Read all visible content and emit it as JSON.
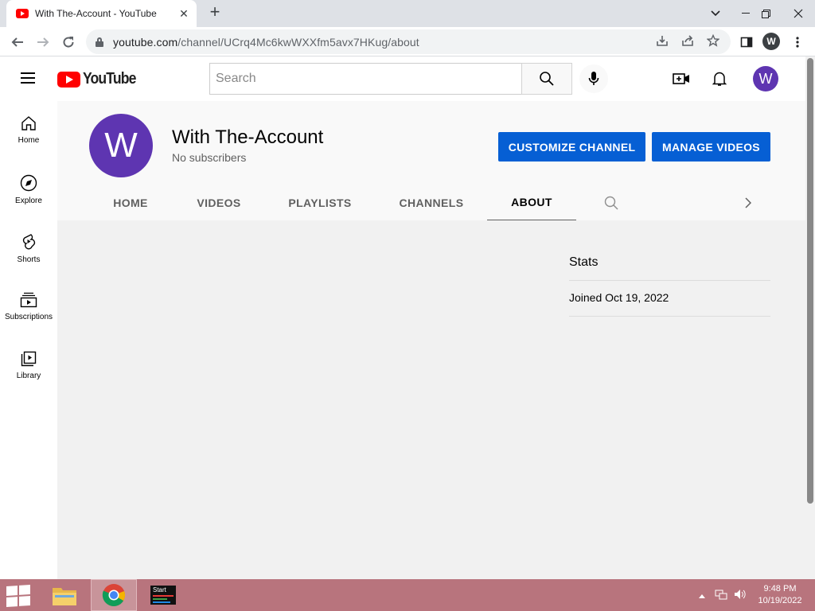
{
  "browser": {
    "tab_title": "With The-Account - YouTube",
    "url_host": "youtube.com",
    "url_path": "/channel/UCrq4Mc6kwWXXfm5avx7HKug/about",
    "profile_initial": "W"
  },
  "header": {
    "logo_text": "YouTube",
    "search_placeholder": "Search",
    "avatar_initial": "W"
  },
  "sidebar": {
    "items": [
      {
        "label": "Home",
        "icon": "home-icon"
      },
      {
        "label": "Explore",
        "icon": "compass-icon"
      },
      {
        "label": "Shorts",
        "icon": "shorts-icon"
      },
      {
        "label": "Subscriptions",
        "icon": "subscriptions-icon"
      },
      {
        "label": "Library",
        "icon": "library-icon"
      }
    ]
  },
  "channel": {
    "avatar_initial": "W",
    "name": "With The-Account",
    "subscribers": "No subscribers",
    "customize_label": "CUSTOMIZE CHANNEL",
    "manage_label": "MANAGE VIDEOS",
    "tabs": [
      "HOME",
      "VIDEOS",
      "PLAYLISTS",
      "CHANNELS",
      "ABOUT"
    ],
    "active_tab": "ABOUT"
  },
  "about": {
    "stats_title": "Stats",
    "joined": "Joined Oct 19, 2022"
  },
  "taskbar": {
    "time": "9:48 PM",
    "date": "10/19/2022",
    "start_app_label": "Start"
  },
  "colors": {
    "accent_blue": "#065fd4",
    "avatar_purple": "#5e35b1",
    "taskbar": "#b8747d"
  }
}
